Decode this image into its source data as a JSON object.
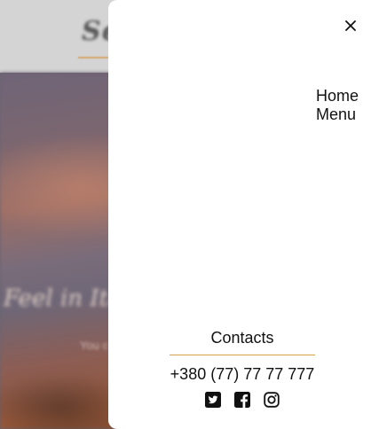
{
  "background": {
    "logo_text": "Se",
    "hero_title": "Feel in Ita",
    "hero_subtitle": "You c"
  },
  "drawer": {
    "close_icon": "close-icon",
    "nav": {
      "items": [
        {
          "label": "Home"
        },
        {
          "label": "Menu"
        }
      ]
    },
    "contacts": {
      "title": "Contacts",
      "phone": "+380 (77) 77 77 777",
      "divider_color": "#d6a14a",
      "socials": [
        {
          "icon": "twitter-icon"
        },
        {
          "icon": "facebook-icon"
        },
        {
          "icon": "instagram-icon"
        }
      ]
    }
  }
}
